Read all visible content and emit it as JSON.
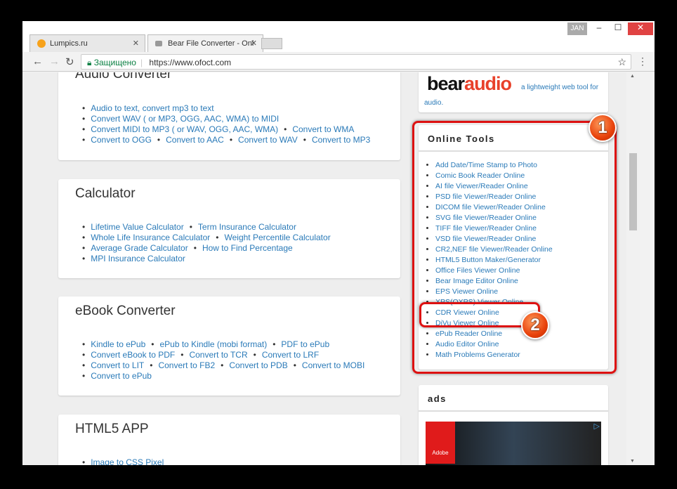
{
  "browser": {
    "tabs": [
      {
        "label": "Lumpics.ru"
      },
      {
        "label": "Bear File Converter - Onl"
      }
    ],
    "user": "JAN",
    "secure_label": "Защищено",
    "url": "https://www.ofoct.com"
  },
  "main": {
    "cards": [
      {
        "title": "Audio Converter",
        "rows": [
          [
            "Audio to text, convert mp3 to text"
          ],
          [
            "Convert WAV ( or MP3, OGG, AAC, WMA) to MIDI"
          ],
          [
            "Convert MIDI to MP3 ( or WAV, OGG, AAC, WMA)",
            "Convert to WMA"
          ],
          [
            "Convert to OGG",
            "Convert to AAC",
            "Convert to WAV",
            "Convert to MP3"
          ]
        ]
      },
      {
        "title": "Calculator",
        "rows": [
          [
            "Lifetime Value Calculator",
            "Term Insurance Calculator"
          ],
          [
            "Whole Life Insurance Calculator",
            "Weight Percentile Calculator"
          ],
          [
            "Average Grade Calculator",
            "How to Find Percentage"
          ],
          [
            "MPI Insurance Calculator"
          ]
        ]
      },
      {
        "title": "eBook Converter",
        "rows": [
          [
            "Kindle to ePub",
            "ePub to Kindle (mobi format)",
            "PDF to ePub"
          ],
          [
            "Convert eBook to PDF",
            "Convert to TCR",
            "Convert to LRF"
          ],
          [
            "Convert to LIT",
            "Convert to FB2",
            "Convert to PDB",
            "Convert to MOBI"
          ],
          [
            "Convert to ePub"
          ]
        ]
      },
      {
        "title": "HTML5 APP",
        "rows": [
          [
            "Image to CSS Pixel"
          ]
        ]
      }
    ]
  },
  "sidebar": {
    "bear_logo": {
      "part1": "bear",
      "part2": "audio"
    },
    "bear_tagline": "a lightweight web tool for audio.",
    "online_tools_title": "Online Tools",
    "tools": [
      "Add Date/Time Stamp to Photo",
      "Comic Book Reader Online",
      "AI file Viewer/Reader Online",
      "PSD file Viewer/Reader Online",
      "DICOM file Viewer/Reader Online",
      "SVG file Viewer/Reader Online",
      "TIFF file Viewer/Reader Online",
      "VSD file Viewer/Reader Online",
      "CR2,NEF file Viewer/Reader Online",
      "HTML5 Button Maker/Generator",
      "Office Files Viewer Online",
      "Bear Image Editor Online",
      "EPS Viewer Online",
      "XPS(OXPS) Viewer Online",
      "CDR Viewer Online",
      "DjVu Viewer Online",
      "ePub Reader Online",
      "Audio Editor Online",
      "Math Problems Generator"
    ],
    "ads_title": "ads",
    "ad_brand": "Adobe"
  },
  "annotations": {
    "badge1": "1",
    "badge2": "2"
  }
}
